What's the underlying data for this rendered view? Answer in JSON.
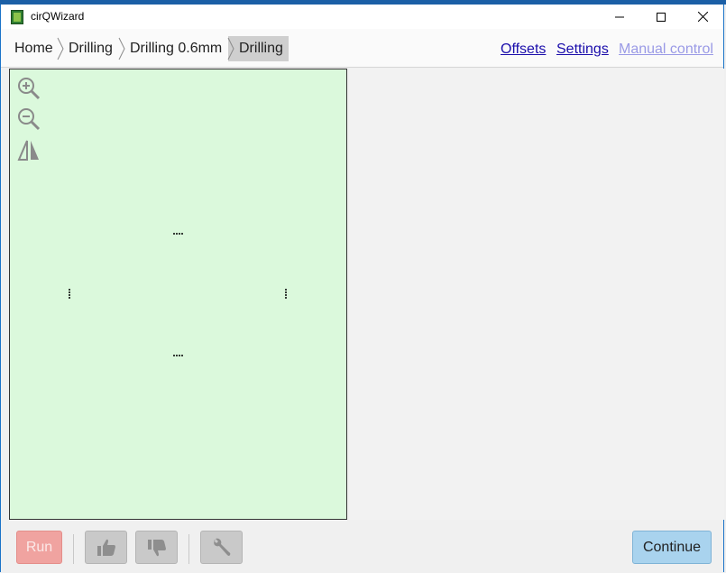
{
  "window": {
    "title": "cirQWizard",
    "minimize_glyph": "—",
    "maximize_glyph": "☐",
    "close_glyph": "✕"
  },
  "breadcrumb": {
    "items": [
      "Home",
      "Drilling",
      "Drilling 0.6mm",
      "Drilling"
    ]
  },
  "links": {
    "offsets": "Offsets",
    "settings": "Settings",
    "manual_control": "Manual control"
  },
  "canvas": {
    "background": "#dbf9dc",
    "tools": [
      "zoom-in-icon",
      "zoom-out-icon",
      "mirror-icon"
    ]
  },
  "footer": {
    "run_label": "Run",
    "continue_label": "Continue",
    "icons": [
      "thumbs-up-icon",
      "thumbs-down-icon",
      "wrench-icon"
    ]
  },
  "colors": {
    "run_button": "#f0a3a0",
    "continue_button": "#a9d3ee",
    "link": "#1a0dab",
    "link_disabled": "#9a9ae6"
  }
}
